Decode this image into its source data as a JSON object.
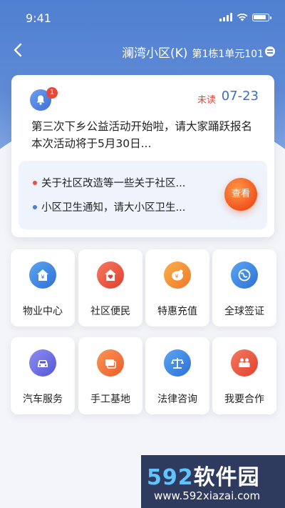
{
  "status": {
    "time": "9:41"
  },
  "nav": {
    "community": "澜湾小区(K)",
    "unit": "第1栋1单元101"
  },
  "notice": {
    "badge": "1",
    "unread": "未读",
    "date": "07-23",
    "text": "第三次下乡公益活动开始啦，请大家踊跃报名本次活动将于5月30日..."
  },
  "news": {
    "items": [
      {
        "text": "关于社区改造等一些关于社区...",
        "dot_color": "#e8503c"
      },
      {
        "text": "小区卫生通知，请大小区卫生...",
        "dot_color": "#4a7fd8"
      }
    ],
    "view_label": "查看"
  },
  "services": [
    {
      "label": "物业中心",
      "icon": "property-icon",
      "color": "#3c84e0"
    },
    {
      "label": "社区便民",
      "icon": "community-icon",
      "color": "#e8503c"
    },
    {
      "label": "特惠充值",
      "icon": "recharge-icon",
      "color": "#f2892a"
    },
    {
      "label": "全球签证",
      "icon": "visa-icon",
      "color": "#3c84e0"
    },
    {
      "label": "汽车服务",
      "icon": "car-icon",
      "color": "#6f6fe0"
    },
    {
      "label": "手工基地",
      "icon": "craft-icon",
      "color": "#f07838"
    },
    {
      "label": "法律咨询",
      "icon": "law-icon",
      "color": "#3c84e0"
    },
    {
      "label": "我要合作",
      "icon": "cooperate-icon",
      "color": "#e8503c"
    }
  ],
  "watermark": {
    "brand_digits": "592",
    "brand_text": "软件园",
    "url": "www.592xiazai.com"
  }
}
